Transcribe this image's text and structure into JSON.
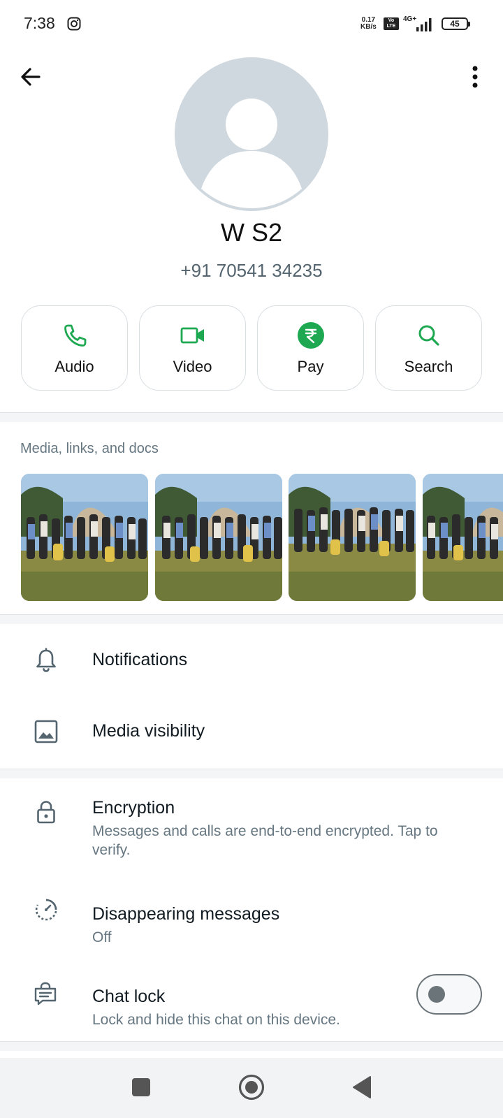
{
  "status_bar": {
    "time": "7:38",
    "net_speed_value": "0.17",
    "net_speed_unit": "KB/s",
    "volte": "Vo LTE",
    "network_type": "4G+",
    "battery": "45"
  },
  "contact": {
    "name": "W S2",
    "phone": "+91 70541 34235"
  },
  "actions": [
    {
      "label": "Audio",
      "icon": "phone-icon"
    },
    {
      "label": "Video",
      "icon": "video-camera-icon"
    },
    {
      "label": "Pay",
      "icon": "rupee-icon"
    },
    {
      "label": "Search",
      "icon": "search-icon"
    }
  ],
  "media": {
    "title": "Media, links, and docs"
  },
  "settings": {
    "notifications": "Notifications",
    "media_visibility": "Media visibility",
    "encryption": {
      "title": "Encryption",
      "subtitle": "Messages and calls are end-to-end encrypted. Tap to verify."
    },
    "disappearing": {
      "title": "Disappearing messages",
      "subtitle": "Off"
    },
    "chat_lock": {
      "title": "Chat lock",
      "subtitle": "Lock and hide this chat on this device.",
      "enabled": false
    }
  },
  "colors": {
    "accent_green": "#1da851",
    "icon_gray": "#54656f"
  }
}
